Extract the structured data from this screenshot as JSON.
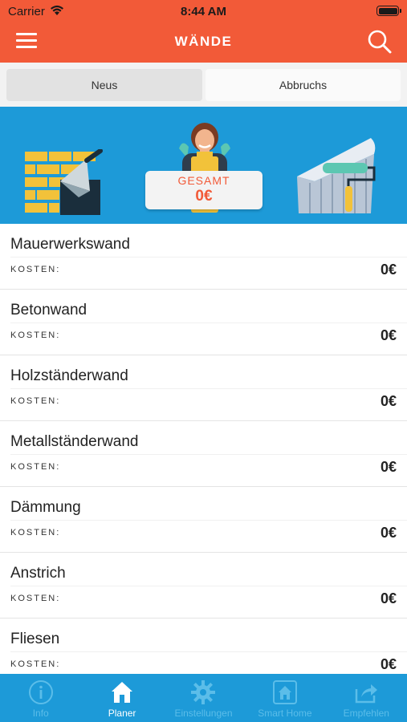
{
  "status": {
    "carrier": "Carrier",
    "time": "8:44 AM"
  },
  "header": {
    "title": "WÄNDE"
  },
  "segments": {
    "new_label": "Neus",
    "demolition_label": "Abbruchs",
    "selected": "Neus"
  },
  "banner": {
    "total_label": "GESAMT",
    "total_value": "0€"
  },
  "list": {
    "cost_label": "KOSTEN:",
    "items": [
      {
        "title": "Mauerwerkswand",
        "cost": "0€"
      },
      {
        "title": "Betonwand",
        "cost": "0€"
      },
      {
        "title": "Holzständerwand",
        "cost": "0€"
      },
      {
        "title": "Metallständerwand",
        "cost": "0€"
      },
      {
        "title": "Dämmung",
        "cost": "0€"
      },
      {
        "title": "Anstrich",
        "cost": "0€"
      },
      {
        "title": "Fliesen",
        "cost": "0€"
      }
    ]
  },
  "tabbar": {
    "active": "Planer",
    "tabs": [
      {
        "label": "Info",
        "icon": "info-icon"
      },
      {
        "label": "Planer",
        "icon": "house-icon"
      },
      {
        "label": "Einstellungen",
        "icon": "gear-icon"
      },
      {
        "label": "Smart Home",
        "icon": "smart-home-icon"
      },
      {
        "label": "Empfehlen",
        "icon": "share-icon"
      }
    ]
  },
  "colors": {
    "primary": "#f25a38",
    "accent": "#1d9ad8",
    "tab_inactive": "#5bbde9"
  }
}
